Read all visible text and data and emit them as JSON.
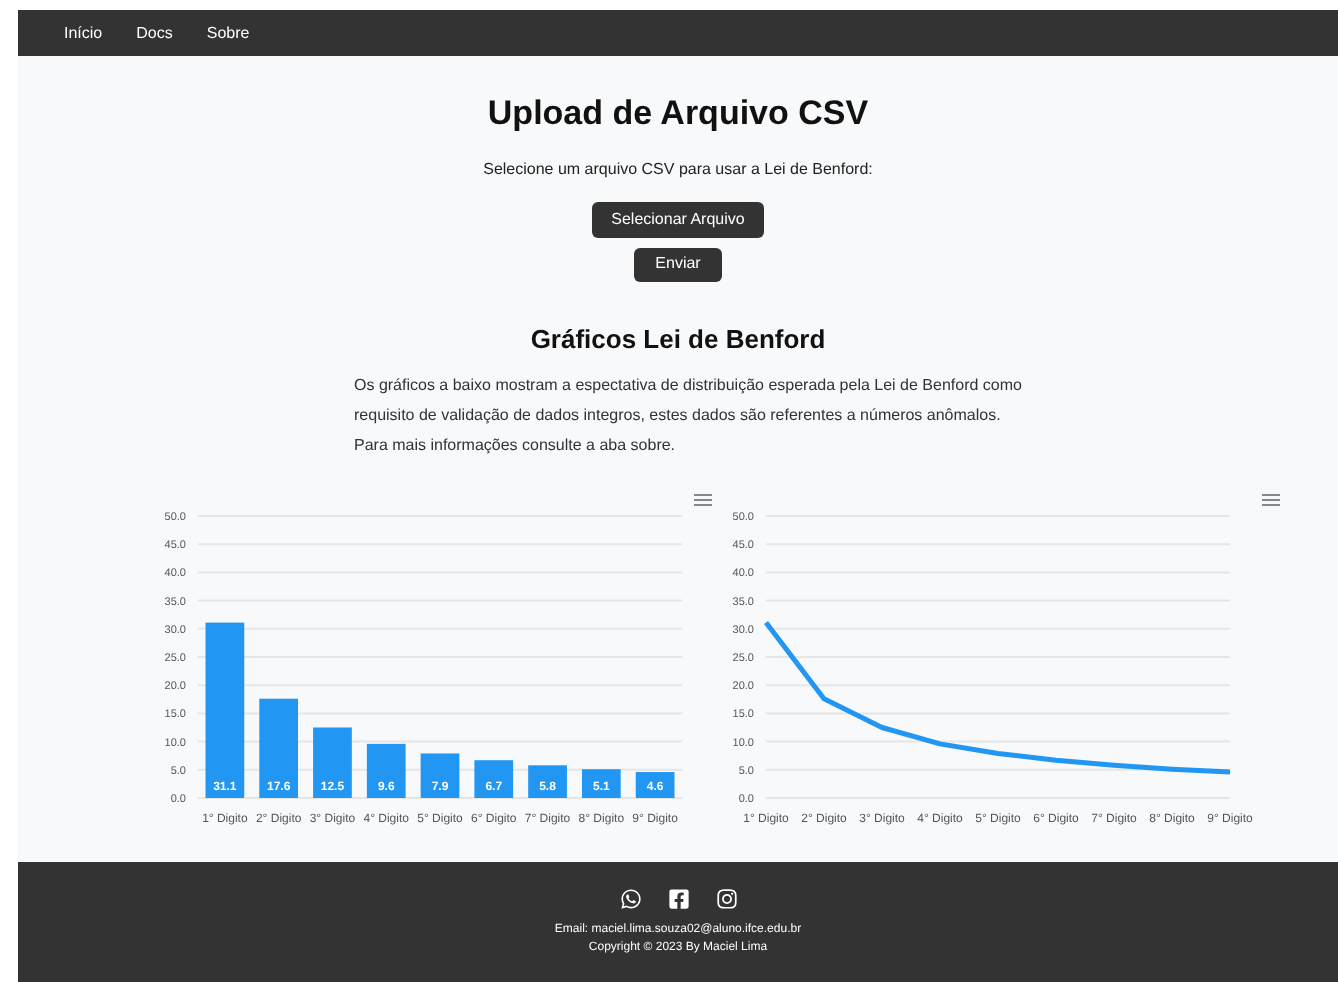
{
  "nav": {
    "items": [
      "Início",
      "Docs",
      "Sobre"
    ]
  },
  "upload": {
    "title": "Upload de Arquivo CSV",
    "instruction": "Selecione um arquivo CSV para usar a Lei de Benford:",
    "select_button": "Selecionar Arquivo",
    "submit_button": "Enviar"
  },
  "charts_section": {
    "title": "Gráficos Lei de Benford",
    "description": [
      "Os gráficos a baixo mostram a espectativa de distribuição esperada pela Lei de Benford como",
      "requisito de validação de dados integros, estes dados são referentes a números anômalos.",
      "Para mais informações consulte a aba sobre."
    ],
    "charts": [
      {
        "chart_data": {
          "type": "bar",
          "categories": [
            "1° Digito",
            "2° Digito",
            "3° Digito",
            "4° Digito",
            "5° Digito",
            "6° Digito",
            "7° Digito",
            "8° Digito",
            "9° Digito"
          ],
          "series": [
            {
              "color": "#2196f3",
              "values": [
                31.1,
                17.6,
                12.5,
                9.6,
                7.9,
                6.7,
                5.8,
                5.1,
                4.6
              ]
            }
          ],
          "ylim": [
            0,
            50
          ],
          "yticks": [
            {
              "value": 0,
              "label": "0.0"
            },
            {
              "value": 5,
              "label": "5.0"
            },
            {
              "value": 10,
              "label": "10.0"
            },
            {
              "value": 15,
              "label": "15.0"
            },
            {
              "value": 20,
              "label": "20.0"
            },
            {
              "value": 25,
              "label": "25.0"
            },
            {
              "value": 30,
              "label": "30.0"
            },
            {
              "value": 35,
              "label": "35.0"
            },
            {
              "value": 40,
              "label": "40.0"
            },
            {
              "value": 45,
              "label": "45.0"
            },
            {
              "value": 50,
              "label": "50.0"
            }
          ],
          "grid": true,
          "data_labels": true
        }
      },
      {
        "chart_data": {
          "type": "line",
          "categories": [
            "1° Digito",
            "2° Digito",
            "3° Digito",
            "4° Digito",
            "5° Digito",
            "6° Digito",
            "7° Digito",
            "8° Digito",
            "9° Digito"
          ],
          "series": [
            {
              "color": "#2196f3",
              "values": [
                31.1,
                17.6,
                12.5,
                9.6,
                7.9,
                6.7,
                5.8,
                5.1,
                4.6
              ]
            }
          ],
          "ylim": [
            0,
            50
          ],
          "yticks": [
            {
              "value": 0,
              "label": "0.0"
            },
            {
              "value": 5,
              "label": "5.0"
            },
            {
              "value": 10,
              "label": "10.0"
            },
            {
              "value": 15,
              "label": "15.0"
            },
            {
              "value": 20,
              "label": "20.0"
            },
            {
              "value": 25,
              "label": "25.0"
            },
            {
              "value": 30,
              "label": "30.0"
            },
            {
              "value": 35,
              "label": "35.0"
            },
            {
              "value": 40,
              "label": "40.0"
            },
            {
              "value": 45,
              "label": "45.0"
            },
            {
              "value": 50,
              "label": "50.0"
            }
          ],
          "grid": true
        }
      }
    ]
  },
  "footer": {
    "email": "Email: maciel.lima.souza02@aluno.ifce.edu.br",
    "copyright": "Copyright © 2023 By Maciel Lima"
  }
}
